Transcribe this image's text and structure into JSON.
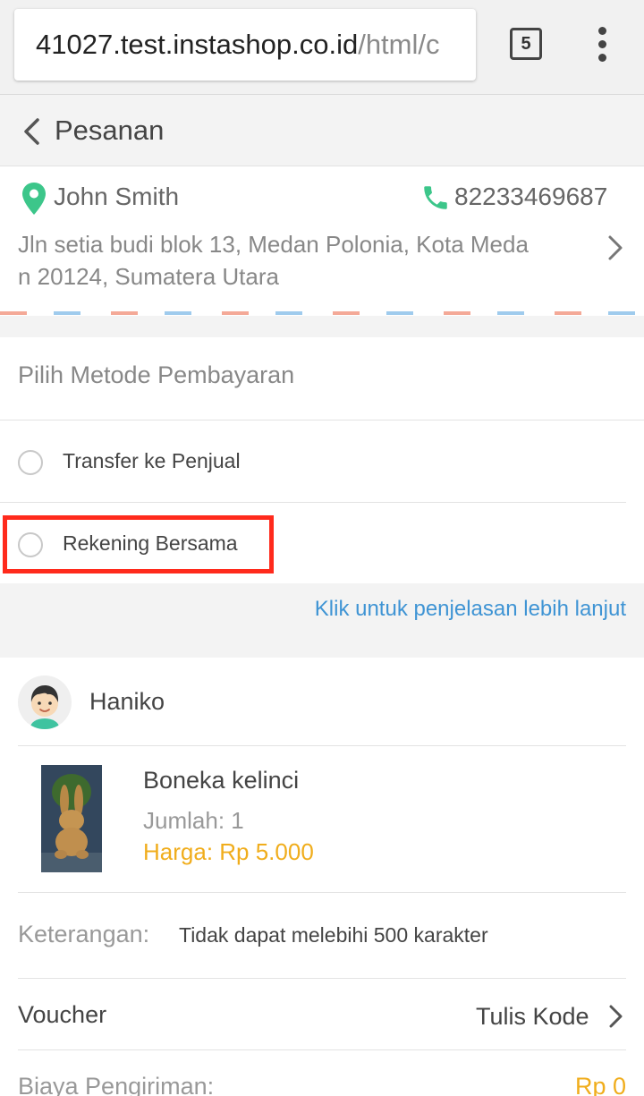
{
  "browser": {
    "url_host": "41027.test.instashop.co.id",
    "url_path": "/html/c",
    "tab_count": "5"
  },
  "header": {
    "title": "Pesanan"
  },
  "address": {
    "name": "John Smith",
    "phone": "82233469687",
    "line1": "Jln setia budi blok 13, Medan Polonia, Kota Meda",
    "line2": "n 20124, Sumatera Utara"
  },
  "payment": {
    "title": "Pilih Metode Pembayaran",
    "options": [
      {
        "label": "Transfer ke Penjual",
        "selected": false
      },
      {
        "label": "Rekening Bersama",
        "selected": false
      }
    ],
    "help_link": "Klik untuk penjelasan lebih lanjut"
  },
  "shop": {
    "name": "Haniko",
    "product": {
      "name": "Boneka kelinci",
      "quantity": "Jumlah: 1",
      "price": "Harga: Rp 5.000"
    },
    "note": {
      "label": "Keterangan:",
      "placeholder": "Tidak dapat melebihi 500 karakter"
    },
    "voucher": {
      "label": "Voucher",
      "action": "Tulis Kode"
    },
    "shipping": {
      "label": "Biaya Pengiriman:",
      "value": "Rp 0"
    }
  },
  "colors": {
    "accent_green": "#3cc68a",
    "link_blue": "#3f94d4",
    "price_orange": "#f0ad1c",
    "highlight_red": "#ff2a1c"
  },
  "icons": [
    "back-arrow-icon",
    "location-pin-icon",
    "phone-icon",
    "chevron-right-icon",
    "tab-count-icon",
    "overflow-menu-icon"
  ]
}
